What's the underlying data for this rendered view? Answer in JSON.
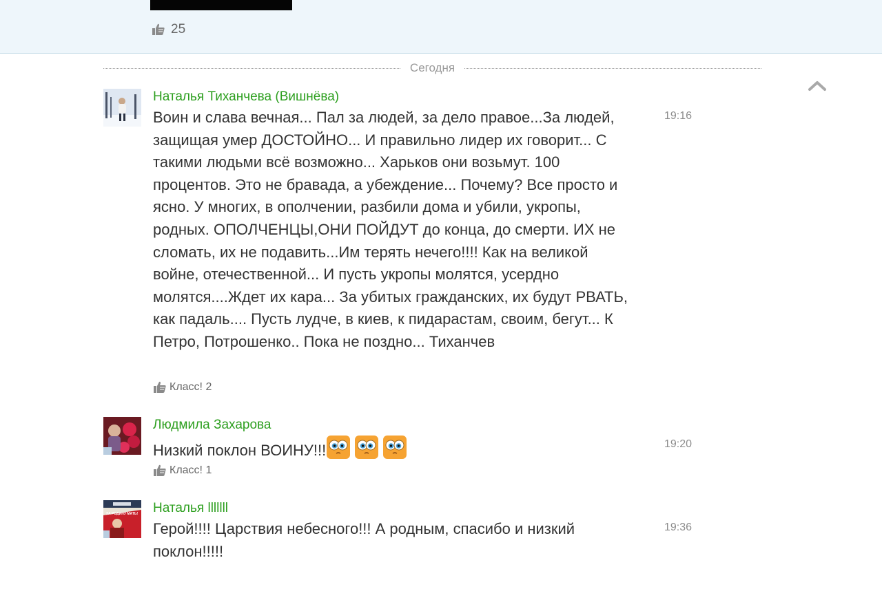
{
  "top_post": {
    "likes": "25"
  },
  "divider": {
    "label": "Сегодня"
  },
  "comments": [
    {
      "author": "Наталья Тиханчева (Вишнёва)",
      "time": "19:16",
      "text": "Воин и слава вечная... Пал за людей, за дело правое...За людей, защищая умер ДОСТОЙНО... И правильно лидер их говорит... С такими людьми всё возможно... Харьков они возьмут. 100 процентов. Это не бравада, а убеждение... Почему? Все просто и ясно. У многих, в ополчении, разбили дома и убили, укропы, родных.  ОПОЛЧЕНЦЫ,ОНИ ПОЙДУТ до конца, до смерти. ИХ не сломать, их не подавить...Им терять нечего!!!! Как на великой войне, отечественной... И пусть укропы молятся, усердно молятся....Ждет их кара... За убитых гражданских, их будут РВАТЬ, как падаль.... Пусть лудче, в киев, к пидарастам, своим, бегут... К Петро, Потрошенко.. Пока не поздно... Тиханчев",
      "klass": "Класс! 2"
    },
    {
      "author": "Людмила Захарова",
      "time": "19:20",
      "text": "Низкий поклон ВОИНУ!!!",
      "emoji_count": 3,
      "klass": "Класс! 1"
    },
    {
      "author": "Наталья lllllll",
      "time": "19:36",
      "text": "Герой!!!! Царствия небесного!!! А родным, спасибо и низкий поклон!!!!!",
      "avatar_text": "ЗА РОДИНУ МАТЬ!"
    }
  ],
  "icons": {
    "like": "thumbs-up-icon",
    "scroll_up": "chevron-up-icon",
    "emoji": "wide-eyed-smiley-icon"
  },
  "colors": {
    "author": "#2d9f1f",
    "time": "#8c8c8c",
    "top_band": "#eef6fb"
  }
}
